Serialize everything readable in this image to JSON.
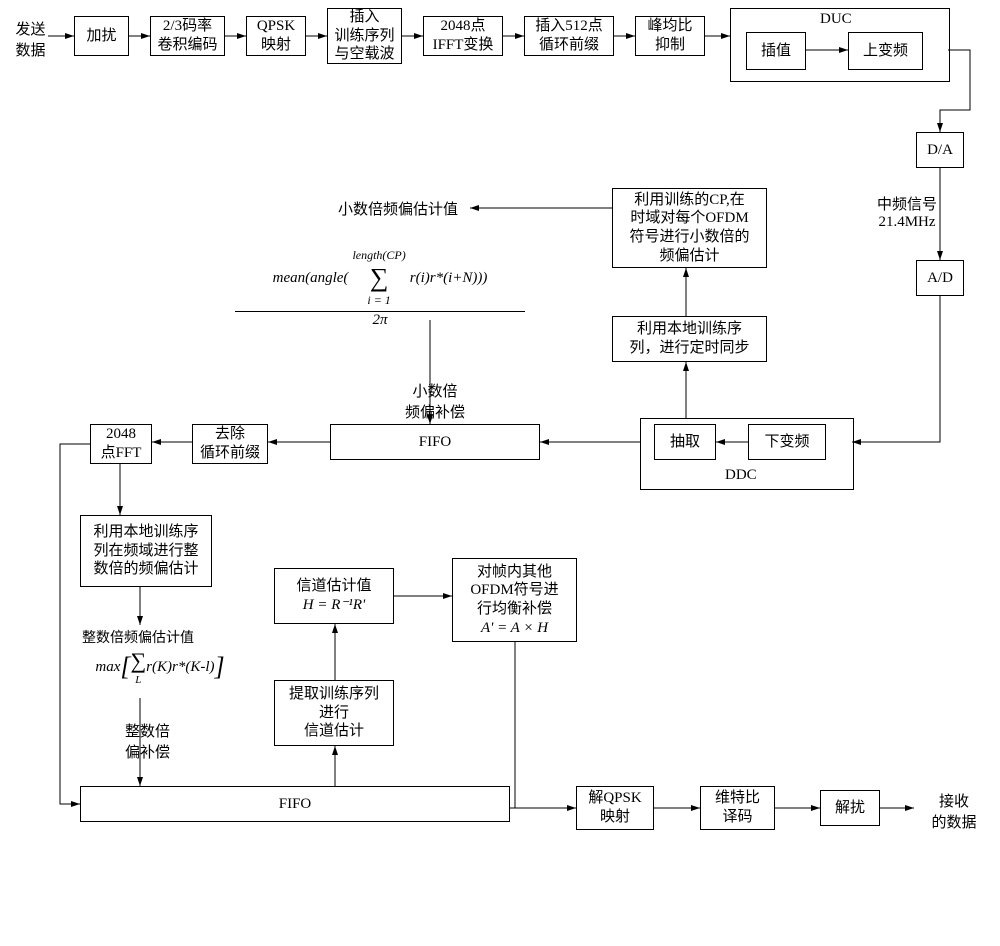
{
  "top": {
    "send_data": "发送\n数据",
    "scramble": "加扰",
    "conv_code": "2/3码率\n卷积编码",
    "qpsk": "QPSK\n映射",
    "train_null": "插入\n训练序列\n与空载波",
    "ifft": "2048点\nIFFT变换",
    "cp_ins": "插入512点\n循环前缀",
    "papr": "峰均比\n抑制",
    "duc_title": "DUC",
    "interp": "插值",
    "upconv": "上变频",
    "da": "D/A",
    "if_note": "中频信号\n21.4MHz",
    "ad": "A/D"
  },
  "mid": {
    "fractional_label": "小数倍频偏估计值",
    "cp_est": "利用训练的CP,在\n时域对每个OFDM\n符号进行小数倍的\n频偏估计",
    "timing": "利用本地训练序\n列，进行定时同步",
    "ddc_title": "DDC",
    "deci": "抽取",
    "downconv": "下变频",
    "fifo1": "FIFO",
    "rm_cp": "去除\n循环前缀",
    "fft": "2048\n点FFT",
    "frac_comp": "小数倍\n频偏补偿",
    "formula_top": "length(CP)",
    "formula_mean": "mean(angle(",
    "formula_sum": "∑",
    "formula_r": "r(i)r*(i+N)))",
    "formula_i": "i = 1",
    "formula_div": "2π"
  },
  "bot": {
    "int_est": "利用本地训练序\n列在频域进行整\n数倍的频偏估计",
    "int_val_label": "整数倍频偏估计值",
    "int_formula_lead": "max",
    "int_formula_sum": "∑",
    "int_formula_sub": "L",
    "int_formula_inner": "r(K)r*(K-l)",
    "int_comp": "整数倍\n偏补偿",
    "fifo2": "FIFO",
    "chan_extract": "提取训练序列\n进行\n信道估计",
    "chan_val_title": "信道估计值",
    "chan_val": "H = R⁻¹R'",
    "eq_box": "对帧内其他\nOFDM符号进\n行均衡补偿",
    "eq_formula": "A' = A × H",
    "de_qpsk": "解QPSK\n映射",
    "viterbi": "维特比\n译码",
    "descramble": "解扰",
    "recv": "接收\n的数据"
  }
}
